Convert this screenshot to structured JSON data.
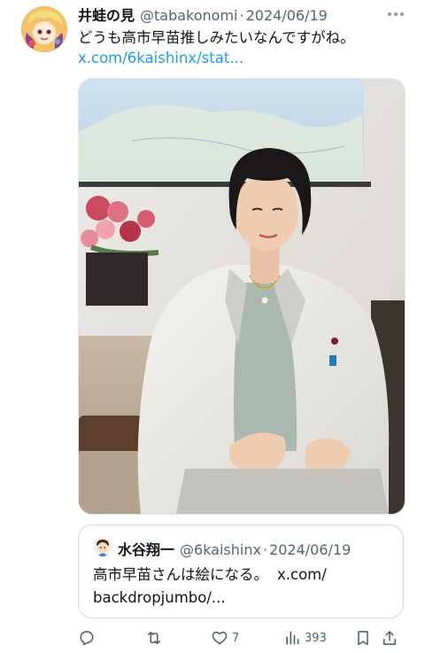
{
  "tweet": {
    "author_name": "井蛙の見",
    "handle": "@tabakonomi",
    "separator": "·",
    "date": "2024/06/19",
    "text": "どうも高市早苗推しみたいなんですがね。",
    "link": "x.com/6kaishinx/stat..."
  },
  "quote": {
    "author_name": "水谷翔一",
    "handle": "@6kaishinx",
    "separator": "·",
    "date": "2024/06/19",
    "text": "高市早苗さんは絵になる。",
    "link_part1": "x.com/",
    "link_part2": "backdropjumbo/..."
  },
  "actions": {
    "reply_icon": "reply-icon",
    "repost_icon": "repost-icon",
    "like_icon": "heart-icon",
    "like_count": "7",
    "views_icon": "views-icon",
    "views_count": "393",
    "bookmark_icon": "bookmark-icon",
    "share_icon": "share-icon"
  },
  "colors": {
    "text": "#0f1419",
    "secondary": "#536471",
    "link": "#1d9bf0",
    "border": "#cfd9de"
  }
}
